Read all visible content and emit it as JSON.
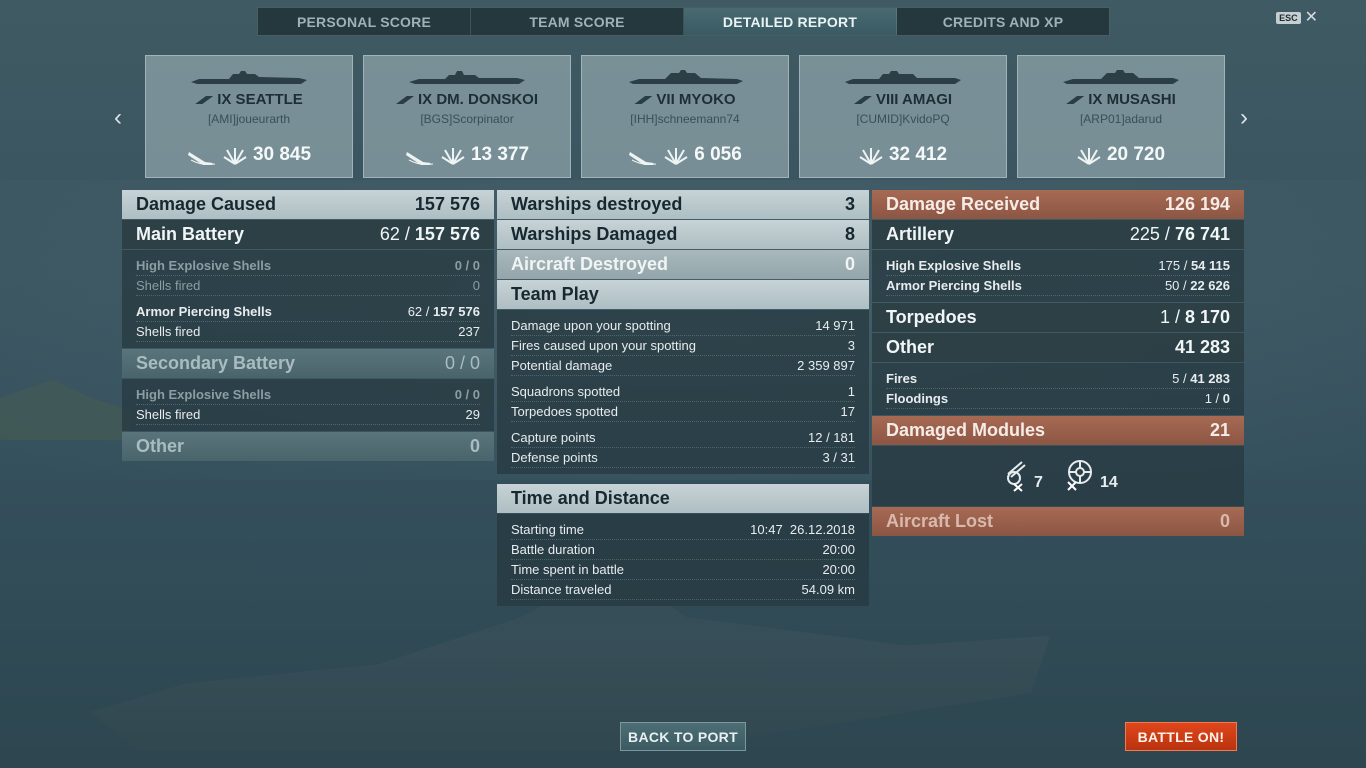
{
  "tabs": [
    "PERSONAL SCORE",
    "TEAM SCORE",
    "DETAILED REPORT",
    "CREDITS AND XP"
  ],
  "active_tab": "DETAILED REPORT",
  "esc_label": "ESC",
  "close_glyph": "✕",
  "nav": {
    "prev": "‹",
    "next": "›"
  },
  "cards": [
    {
      "ship": "IX SEATTLE",
      "player": "[AMI]joueurarth",
      "damage": "30 845",
      "sunk": true
    },
    {
      "ship": "IX DM. DONSKOI",
      "player": "[BGS]Scorpinator",
      "damage": "13 377",
      "sunk": true
    },
    {
      "ship": "VII MYOKO",
      "player": "[IHH]schneemann74",
      "damage": "6 056",
      "sunk": true
    },
    {
      "ship": "VIII AMAGI",
      "player": "[CUMID]KvidoPQ",
      "damage": "32 412",
      "sunk": false
    },
    {
      "ship": "IX MUSASHI",
      "player": "[ARP01]adarud",
      "damage": "20 720",
      "sunk": false
    }
  ],
  "left": {
    "damage_caused": {
      "label": "Damage Caused",
      "value": "157 576"
    },
    "main_battery": {
      "label": "Main Battery",
      "hits": "62 / ",
      "value": "157 576"
    },
    "he_shells": {
      "label": "High Explosive Shells",
      "value": "0 / 0"
    },
    "he_fired": {
      "label": "Shells fired",
      "value": "0"
    },
    "ap_shells": {
      "label": "Armor Piercing Shells",
      "hits": "62 / ",
      "value": "157 576"
    },
    "ap_fired": {
      "label": "Shells fired",
      "value": "237"
    },
    "secondary": {
      "label": "Secondary Battery",
      "value": "0 / 0"
    },
    "sec_he": {
      "label": "High Explosive Shells",
      "value": "0 / 0"
    },
    "sec_fired": {
      "label": "Shells fired",
      "value": "29"
    },
    "other": {
      "label": "Other",
      "value": "0"
    }
  },
  "middle": {
    "destroyed": {
      "label": "Warships destroyed",
      "value": "3"
    },
    "damaged": {
      "label": "Warships Damaged",
      "value": "8"
    },
    "aircraft": {
      "label": "Aircraft Destroyed",
      "value": "0"
    },
    "team_play": {
      "label": "Team Play"
    },
    "spot_damage": {
      "label": "Damage upon your spotting",
      "value": "14 971"
    },
    "spot_fires": {
      "label": "Fires caused upon your spotting",
      "value": "3"
    },
    "potential": {
      "label": "Potential damage",
      "value": "2 359 897"
    },
    "squadrons": {
      "label": "Squadrons spotted",
      "value": "1"
    },
    "torps_spotted": {
      "label": "Torpedoes spotted",
      "value": "17"
    },
    "capture": {
      "label": "Capture points",
      "value": "12 / 181"
    },
    "defense": {
      "label": "Defense points",
      "value": "3 / 31"
    },
    "time_dist": {
      "label": "Time and Distance"
    },
    "start": {
      "label": "Starting time",
      "value": "10:47  26.12.2018"
    },
    "duration": {
      "label": "Battle duration",
      "value": "20:00"
    },
    "time_spent": {
      "label": "Time spent in battle",
      "value": "20:00"
    },
    "distance": {
      "label": "Distance traveled",
      "value": "54.09 km"
    }
  },
  "right": {
    "received": {
      "label": "Damage Received",
      "value": "126 194"
    },
    "artillery": {
      "label": "Artillery",
      "hits": "225 / ",
      "value": "76 741"
    },
    "he": {
      "label": "High Explosive Shells",
      "hits": "175 / ",
      "value": "54 115"
    },
    "ap": {
      "label": "Armor Piercing Shells",
      "hits": "50 / ",
      "value": "22 626"
    },
    "torpedoes": {
      "label": "Torpedoes",
      "hits": "1 / ",
      "value": "8 170"
    },
    "other": {
      "label": "Other",
      "value": "41 283"
    },
    "fires": {
      "label": "Fires",
      "hits": "5 / ",
      "value": "41 283"
    },
    "floodings": {
      "label": "Floodings",
      "hits": "1 / ",
      "value": "0"
    },
    "modules": {
      "label": "Damaged Modules",
      "value": "21"
    },
    "module_guns": {
      "icon": "gun-turret-icon",
      "count": "7"
    },
    "module_steering": {
      "icon": "steering-icon",
      "count": "14"
    },
    "aircraft_lost": {
      "label": "Aircraft Lost",
      "value": "0"
    }
  },
  "buttons": {
    "back": "BACK TO PORT",
    "battle": "BATTLE ON!"
  },
  "colors": {
    "accent_orange": "#a76a53",
    "battle_button": "#d03e16",
    "active_tab": "#4a6a72"
  }
}
